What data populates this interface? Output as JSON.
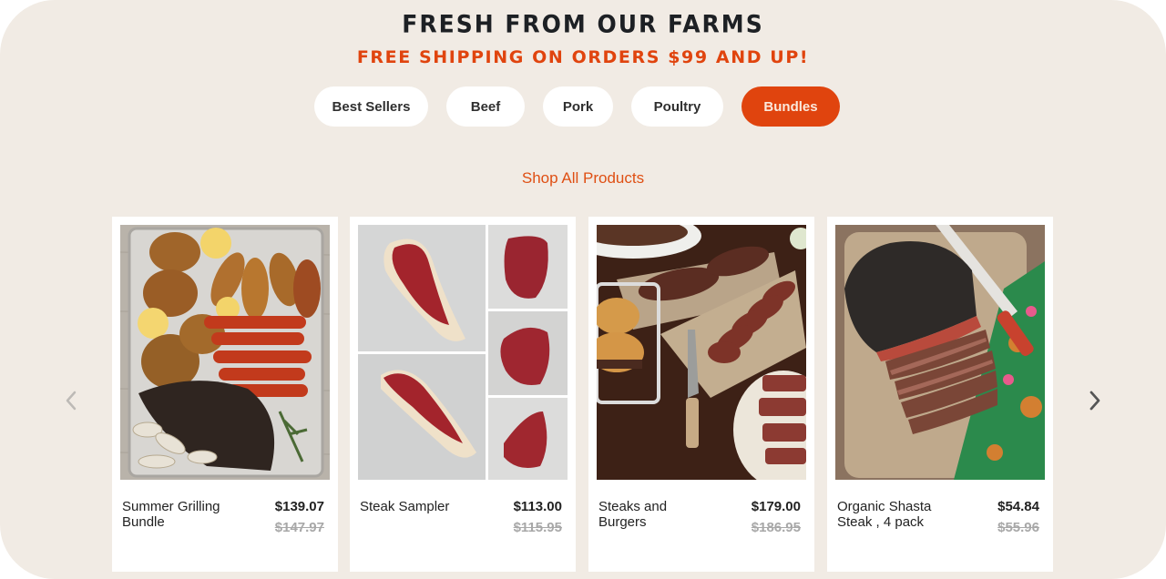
{
  "header": {
    "title": "FRESH FROM OUR FARMS",
    "subtitle": "FREE SHIPPING ON ORDERS $99 AND UP!"
  },
  "tabs": [
    {
      "label": "Best Sellers",
      "active": false
    },
    {
      "label": "Beef",
      "active": false
    },
    {
      "label": "Pork",
      "active": false
    },
    {
      "label": "Poultry",
      "active": false
    },
    {
      "label": "Bundles",
      "active": true
    }
  ],
  "shop_all_label": "Shop All Products",
  "carousel": {
    "prev_icon": "chevron-left-icon",
    "next_icon": "chevron-right-icon",
    "products": [
      {
        "name": "Summer Grilling Bundle",
        "price": "$139.07",
        "original_price": "$147.97",
        "image": "grilled chicken, sausages and brisket on a sheet pan"
      },
      {
        "name": "Steak Sampler",
        "price": "$113.00",
        "original_price": "$115.95",
        "image": "five raw steak cuts on grey background"
      },
      {
        "name": "Steaks and Burgers",
        "price": "$179.00",
        "original_price": "$186.95",
        "image": "sliced steaks on cutting boards with burgers and knife"
      },
      {
        "name": "Organic Shasta Steak , 4 pack",
        "price": "$54.84",
        "original_price": "$55.96",
        "image": "sliced roast steak on a board with knife and colorful cloth"
      }
    ]
  },
  "colors": {
    "background": "#f1ebe4",
    "accent": "#e0440e",
    "heading": "#1d2024",
    "card": "#ffffff",
    "strikethrough": "#a8a8a8"
  }
}
